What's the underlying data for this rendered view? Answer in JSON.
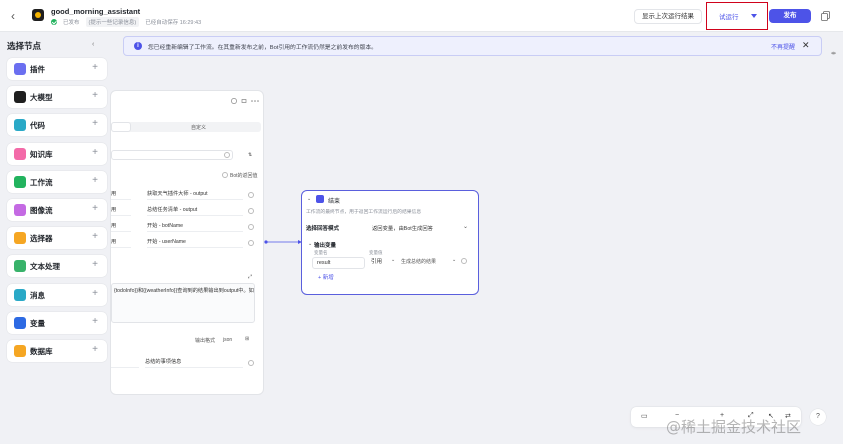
{
  "app": {
    "name": "good_morning_assistant",
    "status": "已发布",
    "status_chip": "(提示一些记录信息)",
    "autosave": "已经自动保存 16:29:43"
  },
  "toolbar": {
    "run_history": "显示上次运行结果",
    "trial_run": "试运行",
    "publish": "发布"
  },
  "banner": {
    "text": "您已经重新编辑了工作流。在其重新发布之前，Bot引用的工作流仍然是之前发布的版本。",
    "dismiss": "不再提醒"
  },
  "panel": {
    "title": "选择节点",
    "items": [
      {
        "label": "插件",
        "icon": "plugin-icon",
        "color": "#6b6ff0"
      },
      {
        "label": "大模型",
        "icon": "llm-icon",
        "color": "#1f1f1f"
      },
      {
        "label": "代码",
        "icon": "code-icon",
        "color": "#2aa9c7"
      },
      {
        "label": "知识库",
        "icon": "knowledge-icon",
        "color": "#f36aa8"
      },
      {
        "label": "工作流",
        "icon": "workflow-icon",
        "color": "#22b35e"
      },
      {
        "label": "图像流",
        "icon": "image-flow-icon",
        "color": "#c46ae3"
      },
      {
        "label": "选择器",
        "icon": "selector-icon",
        "color": "#f5a623"
      },
      {
        "label": "文本处理",
        "icon": "text-icon",
        "color": "#38b26a"
      },
      {
        "label": "消息",
        "icon": "message-icon",
        "color": "#2aa9c7"
      },
      {
        "label": "变量",
        "icon": "variable-icon",
        "color": "#2d6ae3"
      },
      {
        "label": "数据库",
        "icon": "database-icon",
        "color": "#f5a623"
      }
    ]
  },
  "left_card": {
    "tab_right": "自定义",
    "bot_option": "Bot的返回值",
    "rows": [
      {
        "mode": "用",
        "ref": "获取天气插件大师 - output"
      },
      {
        "mode": "用",
        "ref": "总结任务清单 - output"
      },
      {
        "mode": "用",
        "ref": "开始 - botName"
      },
      {
        "mode": "用",
        "ref": "开始 - userName"
      }
    ],
    "prompt_text": "{todoInfo}}和{{weatherInfo}}查询到的结果输出到output中。如",
    "output_format": "输出格式",
    "output_format_value": "json",
    "bottom_value": "总结的事项信息"
  },
  "end_node": {
    "title": "结束",
    "description": "工作流的最终节点，用于返回工作流运行后的结果信息",
    "answer_mode_label": "选择回答模式",
    "answer_mode_value": "返回变量，由Bot生成回答",
    "output_vars_title": "输出变量",
    "col_var": "变量名",
    "col_val": "变量值",
    "var_name": "result",
    "var_ref": "引用",
    "var_source": "生成总结的结果",
    "add_label": "新增"
  },
  "bottom_toolbar": {
    "zoom_out": "−",
    "zoom_in": "+",
    "help": "?"
  },
  "watermark": "@稀土掘金技术社区"
}
